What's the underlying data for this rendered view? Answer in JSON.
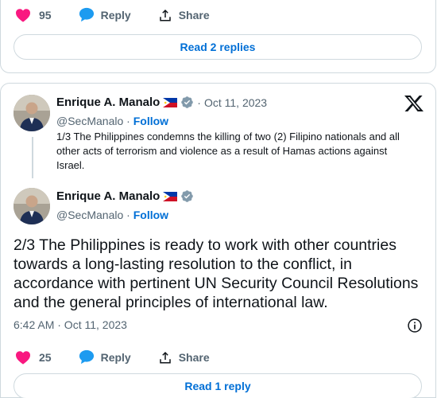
{
  "top_tweet": {
    "likes": "95",
    "reply_label": "Reply",
    "share_label": "Share",
    "read_replies": "Read 2 replies"
  },
  "quoted": {
    "author_name": "Enrique A. Manalo",
    "handle": "@SecManalo",
    "separator": "·",
    "follow_label": "Follow",
    "date": "Oct 11, 2023",
    "text": "1/3 The Philippines condemns the killing of two (2) Filipino nationals and all other acts of terrorism and violence as a result of Hamas actions against Israel."
  },
  "main": {
    "author_name": "Enrique A. Manalo",
    "handle": "@SecManalo",
    "separator": "·",
    "follow_label": "Follow",
    "text": "2/3 The Philippines is ready to work with other countries towards a long-lasting resolution to the conflict, in accordance with pertinent UN Security Council Resolutions and the general principles of international law.",
    "timestamp": "6:42 AM · Oct 11, 2023",
    "likes": "25",
    "reply_label": "Reply",
    "share_label": "Share",
    "read_replies": "Read 1 reply"
  },
  "colors": {
    "like": "#f91880",
    "reply": "#1d9bf0",
    "link": "#006fd6",
    "muted": "#536471",
    "border": "#cfd9de"
  },
  "icons": {
    "like": "heart-icon",
    "reply": "speech-bubble-icon",
    "share": "share-upload-icon",
    "verified": "verified-badge-icon",
    "flag": "philippines-flag-icon",
    "brand": "x-logo-icon",
    "info": "info-icon"
  }
}
